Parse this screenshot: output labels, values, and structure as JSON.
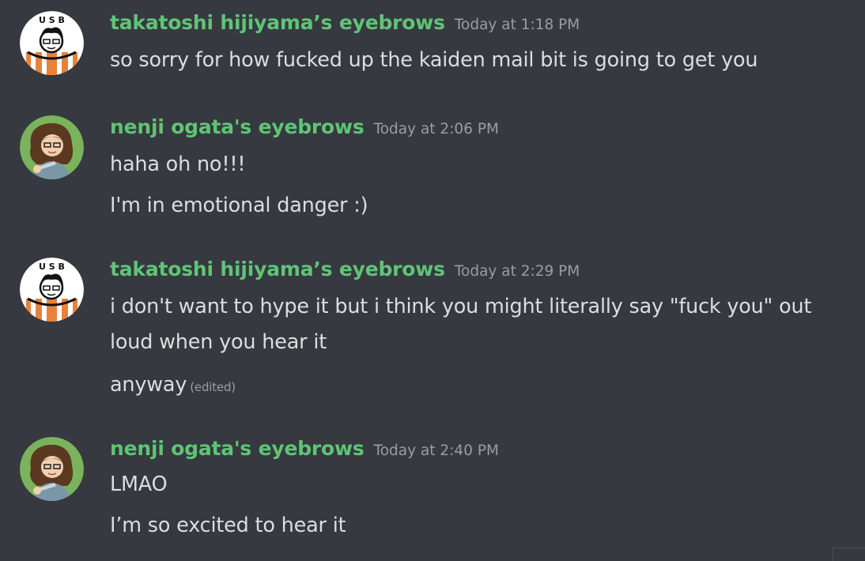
{
  "messages": [
    {
      "username": "takatoshi hijiyama’s eyebrows",
      "timestamp": "Today at 1:18 PM",
      "avatar_icon": "usb-logo-avatar",
      "lines": [
        "so sorry for how fucked up the kaiden mail bit is going to get you"
      ]
    },
    {
      "username": "nenji ogata's eyebrows",
      "timestamp": "Today at 2:06 PM",
      "avatar_icon": "curly-hair-avatar",
      "lines": [
        "haha oh no!!!",
        "I'm in emotional danger :)"
      ]
    },
    {
      "username": "takatoshi hijiyama’s eyebrows",
      "timestamp": "Today at 2:29 PM",
      "avatar_icon": "usb-logo-avatar",
      "lines": [
        "i don't want to hype it but i think you might literally say \"fuck you\" out",
        "loud when you hear it",
        "anyway"
      ],
      "edited_label": "(edited)"
    },
    {
      "username": "nenji ogata's eyebrows",
      "timestamp": "Today at 2:40 PM",
      "avatar_icon": "curly-hair-avatar",
      "lines": [
        "LMAO",
        "I’m so excited to hear it"
      ]
    }
  ],
  "colors": {
    "background": "#36393f",
    "username": "#5fc476",
    "text": "#dcddde",
    "timestamp": "#9a9da3"
  }
}
